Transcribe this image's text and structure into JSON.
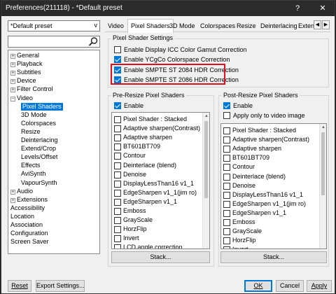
{
  "window": {
    "title": "Preferences(211118) - *Default preset",
    "help_label": "?",
    "close_label": "✕"
  },
  "left": {
    "preset_value": "*Default preset",
    "tree": [
      {
        "label": "General",
        "level": 0,
        "expander": "+"
      },
      {
        "label": "Playback",
        "level": 0,
        "expander": "+"
      },
      {
        "label": "Subtitles",
        "level": 0,
        "expander": "+"
      },
      {
        "label": "Device",
        "level": 0,
        "expander": "+"
      },
      {
        "label": "Filter Control",
        "level": 0,
        "expander": "+"
      },
      {
        "label": "Video",
        "level": 0,
        "expander": "−"
      },
      {
        "label": "Pixel Shaders",
        "level": 1,
        "selected": true
      },
      {
        "label": "3D Mode",
        "level": 1
      },
      {
        "label": "Colorspaces",
        "level": 1
      },
      {
        "label": "Resize",
        "level": 1
      },
      {
        "label": "Deinterlacing",
        "level": 1
      },
      {
        "label": "Extend/Crop",
        "level": 1
      },
      {
        "label": "Levels/Offset",
        "level": 1
      },
      {
        "label": "Effects",
        "level": 1
      },
      {
        "label": "AviSynth",
        "level": 1
      },
      {
        "label": "VapourSynth",
        "level": 1
      },
      {
        "label": "Audio",
        "level": 0,
        "expander": "+"
      },
      {
        "label": "Extensions",
        "level": 0,
        "expander": "+"
      },
      {
        "label": "Accessibility",
        "level": 0
      },
      {
        "label": "Location",
        "level": 0
      },
      {
        "label": "Association",
        "level": 0
      },
      {
        "label": "Configuration",
        "level": 0
      },
      {
        "label": "Screen Saver",
        "level": 0
      }
    ]
  },
  "tabs": [
    "Video",
    "Pixel Shaders",
    "3D Mode",
    "Colorspaces",
    "Resize",
    "Deinterlacing",
    "Extens"
  ],
  "tab_scroll": {
    "left": "◀",
    "right": "▶"
  },
  "settings": {
    "title": "Pixel Shader Settings",
    "options": [
      {
        "label": "Enable Display ICC Color Gamut Correction",
        "checked": false
      },
      {
        "label": "Enable YCgCo Colorspace Correction",
        "checked": true
      },
      {
        "label": "Enable SMPTE ST 2084 HDR Correction",
        "checked": true
      },
      {
        "label": "Enable SMPTE ST 2086 HDR Correction",
        "checked": true
      }
    ]
  },
  "pre": {
    "title": "Pre-Resize Pixel Shaders",
    "enable_label": "Enable",
    "enable_checked": true,
    "items": [
      "Pixel Shader : Stacked",
      "Adaptive sharpen(Contrast)",
      "Adaptive sharpen",
      "BT601BT709",
      "Contour",
      "Deinterlace (blend)",
      "Denoise",
      "DisplayLessThan16 v1_1",
      "EdgeSharpen v1_1(jim ro)",
      "EdgeSharpen v1_1",
      "Emboss",
      "GrayScale",
      "HorzFlip",
      "Invert",
      "LCD angle correction"
    ],
    "stack_label": "Stack..."
  },
  "post": {
    "title": "Post-Resize Pixel Shaders",
    "enable_label": "Enable",
    "enable_checked": true,
    "only_label": "Apply only to video image",
    "only_checked": false,
    "items": [
      "Pixel Shader : Stacked",
      "Adaptive sharpen(Contrast)",
      "Adaptive sharpen",
      "BT601BT709",
      "Contour",
      "Deinterlace (blend)",
      "Denoise",
      "DisplayLessThan16 v1_1",
      "EdgeSharpen v1_1(jim ro)",
      "EdgeSharpen v1_1",
      "Emboss",
      "GrayScale",
      "HorzFlip",
      "Invert"
    ],
    "stack_label": "Stack..."
  },
  "footer": {
    "reset_label": "Reset",
    "export_label": "Export Settings...",
    "ok_label": "OK",
    "cancel_label": "Cancel",
    "apply_label": "Apply"
  },
  "colors": {
    "accent": "#0078d7",
    "highlight": "#e0101e",
    "titlebar": "#2b2b2b"
  }
}
